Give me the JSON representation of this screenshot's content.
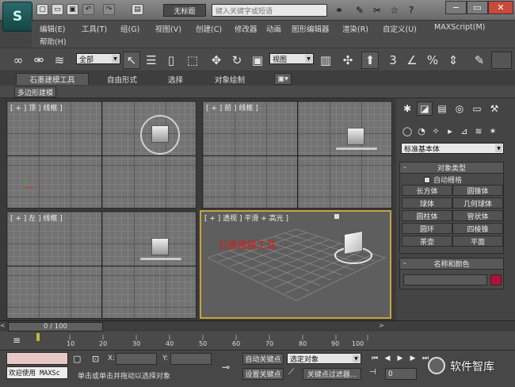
{
  "titlebar": {
    "logo": "S",
    "doc_title": "无标题",
    "search_placeholder": "键入关键字或短语"
  },
  "menu": {
    "row1": [
      "编辑(E)",
      "工具(T)",
      "组(G)",
      "视图(V)",
      "创建(C)",
      "修改器",
      "动画",
      "图形编辑器",
      "渲染(R)",
      "自定义(U)",
      "MAXScript(M)"
    ],
    "row2": [
      "帮助(H)"
    ]
  },
  "toolbar": {
    "selection_filter": "全部",
    "reference_coord": "视图",
    "snap_label": "3",
    "angle_snap_label": "∠",
    "percent_snap_label": "%"
  },
  "ribbon": {
    "tabs": [
      "石墨建模工具",
      "自由形式",
      "选择",
      "对象绘制"
    ],
    "subtab": "多边形建模"
  },
  "viewports": {
    "top": "[ + ] 顶 ] 线框 ]",
    "front": "[ + ] 前 ] 线框 ]",
    "left": "[ + ] 左 ] 线框 ]",
    "perspective": "[ + ] 透视 ] 平滑 + 高光 ]",
    "overlay_text": "石墨建模工具"
  },
  "command_panel": {
    "primitive_type": "标准基本体",
    "object_type_title": "对象类型",
    "autogrid_label": "自动栅格",
    "objects": [
      "长方体",
      "圆锥体",
      "球体",
      "几何球体",
      "圆柱体",
      "管状体",
      "圆环",
      "四棱锥",
      "茶壶",
      "平面"
    ],
    "name_color_title": "名称和颜色",
    "object_color": "#b0103a"
  },
  "timeline": {
    "slider_label": "0 / 100",
    "ticks": [
      "10",
      "20",
      "30",
      "40",
      "50",
      "60",
      "70",
      "80",
      "90",
      "100"
    ]
  },
  "status": {
    "maxscript_welcome": "欢迎使用 MAXSc",
    "x_label": "X:",
    "y_label": "Y:",
    "auto_key": "自动关键点",
    "set_key": "设置关键点",
    "key_mode": "选定对象",
    "key_filter": "关键点过滤器...",
    "prompt": "单击或单击并拖动以选择对象",
    "frame": "0"
  },
  "watermark": {
    "text": "软件智库"
  }
}
